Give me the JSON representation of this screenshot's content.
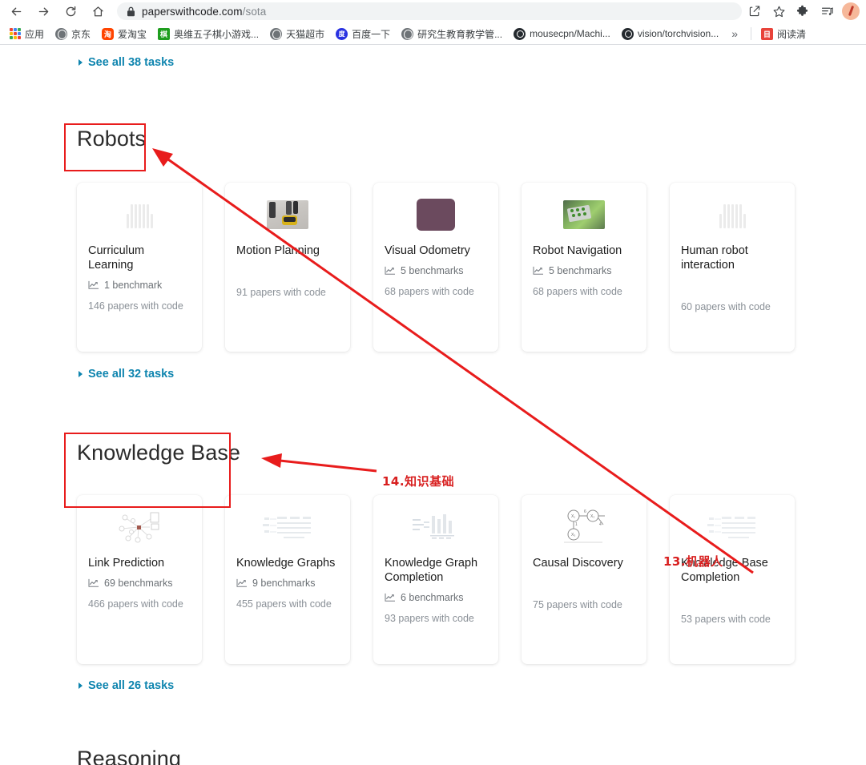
{
  "browser": {
    "url_host": "paperswithcode.com",
    "url_path": "/sota",
    "nav": {
      "back": "back-arrow",
      "forward": "forward-arrow",
      "reload": "reload",
      "home": "home"
    },
    "actions": {
      "share": "share-icon",
      "bookmark": "star-icon",
      "extensions": "puzzle-icon",
      "media": "media-list-icon",
      "profile": "avatar"
    },
    "bookmarks": [
      {
        "label": "应用",
        "icon": "apps-grid-icon"
      },
      {
        "label": "京东",
        "icon": "globe-icon"
      },
      {
        "label": "爱淘宝",
        "icon": "taobao-icon"
      },
      {
        "label": "奥维五子棋小游戏...",
        "icon": "green-square-icon"
      },
      {
        "label": "天猫超市",
        "icon": "globe-icon"
      },
      {
        "label": "百度一下",
        "icon": "baidu-icon"
      },
      {
        "label": "研究生教育教学管...",
        "icon": "globe-icon"
      },
      {
        "label": "mousecpn/Machi...",
        "icon": "github-icon"
      },
      {
        "label": "vision/torchvision...",
        "icon": "github-icon"
      }
    ],
    "overflow_label": "»",
    "reading_list_label": "阅读清",
    "reading_list_icon": "reading-list-icon"
  },
  "page": {
    "top_link": {
      "label": "See all 38 tasks"
    },
    "sections": [
      {
        "title": "Robots",
        "see_all": "See all 32 tasks",
        "cards": [
          {
            "title": "Curriculum Learning",
            "benchmarks": "1 benchmark",
            "papers": "146 papers with code",
            "thumb": "barcode-placeholder-icon"
          },
          {
            "title": "Motion Planning",
            "benchmarks": "",
            "papers": "91 papers with code",
            "thumb": "robot-vacuum-photo"
          },
          {
            "title": "Visual Odometry",
            "benchmarks": "5 benchmarks",
            "papers": "68 papers with code",
            "thumb": "purple-square-thumb"
          },
          {
            "title": "Robot Navigation",
            "benchmarks": "5 benchmarks",
            "papers": "68 papers with code",
            "thumb": "circuit-board-photo"
          },
          {
            "title": "Human robot interaction",
            "benchmarks": "",
            "papers": "60 papers with code",
            "thumb": "barcode-placeholder-icon"
          }
        ]
      },
      {
        "title": "Knowledge Base",
        "see_all": "See all 26 tasks",
        "cards": [
          {
            "title": "Link Prediction",
            "benchmarks": "69 benchmarks",
            "papers": "466 papers with code",
            "thumb": "network-graph-diagram"
          },
          {
            "title": "Knowledge Graphs",
            "benchmarks": "9 benchmarks",
            "papers": "455 papers with code",
            "thumb": "faded-diagram"
          },
          {
            "title": "Knowledge Graph Completion",
            "benchmarks": "6 benchmarks",
            "papers": "93 papers with code",
            "thumb": "faded-chart-diagram"
          },
          {
            "title": "Causal Discovery",
            "benchmarks": "",
            "papers": "75 papers with code",
            "thumb": "causal-graph-diagram"
          },
          {
            "title": "Knowledge Base Completion",
            "benchmarks": "",
            "papers": "53 papers with code",
            "thumb": "faded-diagram"
          }
        ]
      }
    ],
    "next_section_title": "Reasoning"
  },
  "annotations": {
    "note_knowledge_base": "14.知识基础",
    "note_robots": "13.机器人",
    "accent_red": "#e81c1c"
  }
}
